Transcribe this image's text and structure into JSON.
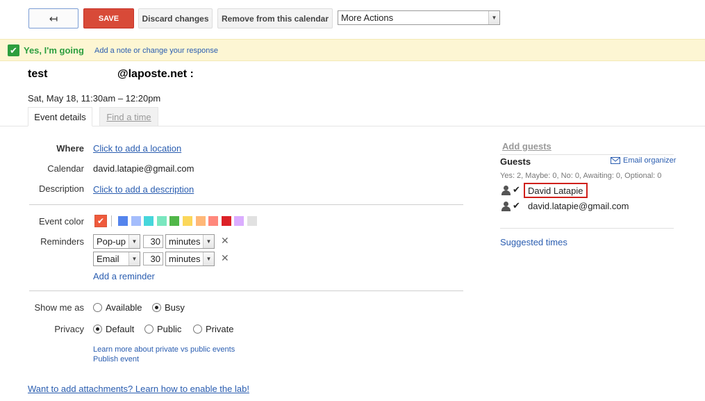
{
  "toolbar": {
    "back_icon": "back-arrow-icon",
    "back_glyph": "↤",
    "save_label": "SAVE",
    "discard_label": "Discard changes",
    "remove_label": "Remove from this calendar",
    "more_actions": "More Actions"
  },
  "rsvp": {
    "status": "Yes, I'm going",
    "note_link": "Add a note or change your response",
    "accent": "#2c9e3f"
  },
  "event": {
    "title": "test",
    "organizer": "@laposte.net :",
    "when": "Sat, May 18, 11:30am – 12:20pm"
  },
  "tabs": [
    {
      "label": "Event details",
      "active": true
    },
    {
      "label": "Find a time",
      "active": false
    }
  ],
  "details": {
    "where_label": "Where",
    "where_link": "Click to add a location",
    "calendar_label": "Calendar",
    "calendar_value": "david.latapie@gmail.com",
    "description_label": "Description",
    "description_link": "Click to add a description",
    "event_color_label": "Event color",
    "colors": [
      "#ef5a3c",
      "#5484ed",
      "#a4bdfc",
      "#46d6db",
      "#7ae7bf",
      "#51b749",
      "#fbd75b",
      "#ffb878",
      "#ff887c",
      "#dc2127",
      "#dbadff",
      "#e1e1e1"
    ],
    "reminders_label": "Reminders",
    "reminders": [
      {
        "method": "Pop-up",
        "amount": "30",
        "unit": "minutes"
      },
      {
        "method": "Email",
        "amount": "30",
        "unit": "minutes"
      }
    ],
    "add_reminder": "Add a reminder",
    "show_me_as_label": "Show me as",
    "show_me_as_options": [
      "Available",
      "Busy"
    ],
    "show_me_as_selected": "Busy",
    "privacy_label": "Privacy",
    "privacy_options": [
      "Default",
      "Public",
      "Private"
    ],
    "privacy_selected": "Default",
    "learn_more": "Learn more about private vs public events",
    "publish": "Publish event",
    "attachments": "Want to add attachments? Learn how to enable the lab!"
  },
  "guests": {
    "add_guests": "Add guests",
    "heading": "Guests",
    "email_organizer": "Email organizer",
    "summary": "Yes: 2, Maybe: 0, No: 0, Awaiting: 0, Optional: 0",
    "list": [
      {
        "name": "David Latapie",
        "highlighted": true
      },
      {
        "name": "david.latapie@gmail.com",
        "highlighted": false
      }
    ],
    "suggested_times": "Suggested times"
  }
}
